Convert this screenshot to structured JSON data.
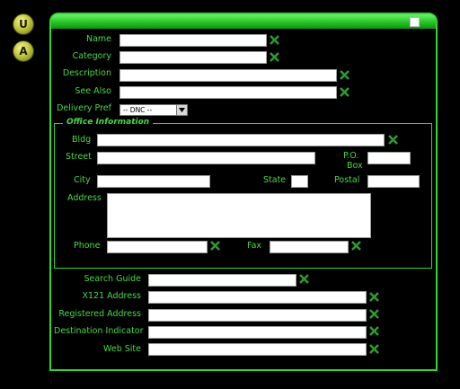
{
  "side": {
    "top_glyph": "U",
    "bottom_glyph": "A"
  },
  "form": {
    "name_label": "Name",
    "category_label": "Category",
    "description_label": "Description",
    "see_also_label": "See Also",
    "delivery_pref_label": "Delivery Pref",
    "delivery_pref_value": "-- DNC --",
    "office_legend": "Office Information",
    "bldg_label": "Bldg",
    "street_label": "Street",
    "po_box_label_line1": "P.O.",
    "po_box_label_line2": "Box",
    "city_label": "City",
    "state_label": "State",
    "postal_label": "Postal",
    "address_label": "Address",
    "phone_label": "Phone",
    "fax_label": "Fax",
    "search_guide_label": "Search Guide",
    "x121_label": "X121 Address",
    "registered_address_label": "Registered Address",
    "destination_indicator_label": "Destination Indicator",
    "website_label": "Web Site"
  },
  "colors": {
    "accent": "#33d633",
    "label": "#49d849",
    "remove_icon": "#2e9a2e"
  },
  "icons": {
    "remove": "x-icon",
    "window": "square-icon",
    "dropdown": "chevron-down-icon"
  }
}
